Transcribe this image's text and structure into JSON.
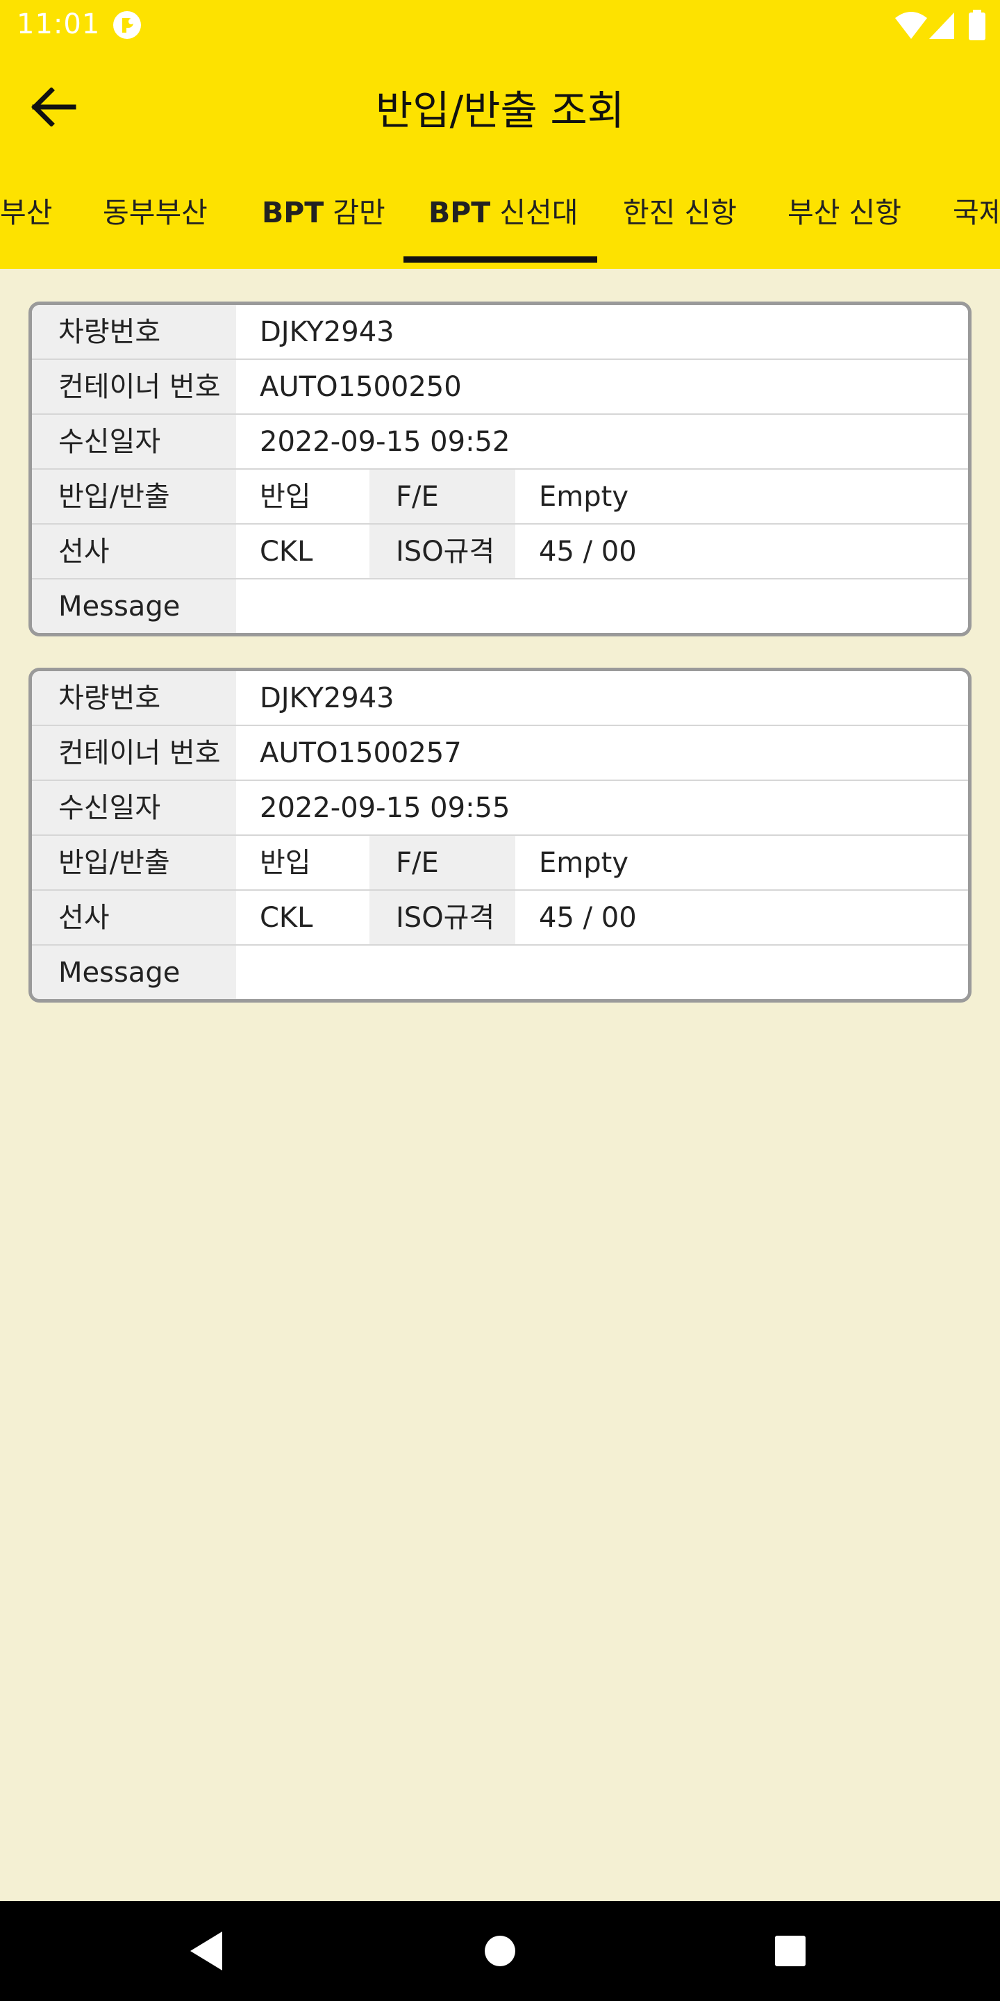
{
  "status_bar": {
    "time": "11:01",
    "icons": [
      "app-notification-icon",
      "wifi-icon",
      "cell-signal-icon",
      "battery-icon"
    ]
  },
  "app_bar": {
    "title": "반입/반출 조회",
    "back_icon": "back-arrow-icon"
  },
  "tabs": [
    {
      "label": "부산",
      "selected": false
    },
    {
      "label": "동부부산",
      "selected": false
    },
    {
      "bold": "BPT",
      "label": " 감만",
      "selected": false
    },
    {
      "bold": "BPT",
      "label": " 신선대",
      "selected": true
    },
    {
      "label": "한진 신항",
      "selected": false
    },
    {
      "label": "부산 신항",
      "selected": false
    },
    {
      "label": "국제",
      "selected": false
    }
  ],
  "labels": {
    "vehicle_no": "차량번호",
    "container_no": "컨테이너 번호",
    "received_at": "수신일자",
    "in_out": "반입/반출",
    "fe": "F/E",
    "carrier": "선사",
    "iso": "ISO규격",
    "message": "Message"
  },
  "records": [
    {
      "vehicle_no": "DJKY2943",
      "container_no": "AUTO1500250",
      "received_at": "2022-09-15 09:52",
      "in_out": "반입",
      "fe": "Empty",
      "carrier": "CKL",
      "iso": "45 / 00",
      "message": ""
    },
    {
      "vehicle_no": "DJKY2943",
      "container_no": "AUTO1500257",
      "received_at": "2022-09-15 09:55",
      "in_out": "반입",
      "fe": "Empty",
      "carrier": "CKL",
      "iso": "45 / 00",
      "message": ""
    }
  ],
  "colors": {
    "primary": "#FDE200",
    "background": "#F4F0D3",
    "label_bg": "#EFEFEF",
    "card_border": "#9A9A9A"
  }
}
